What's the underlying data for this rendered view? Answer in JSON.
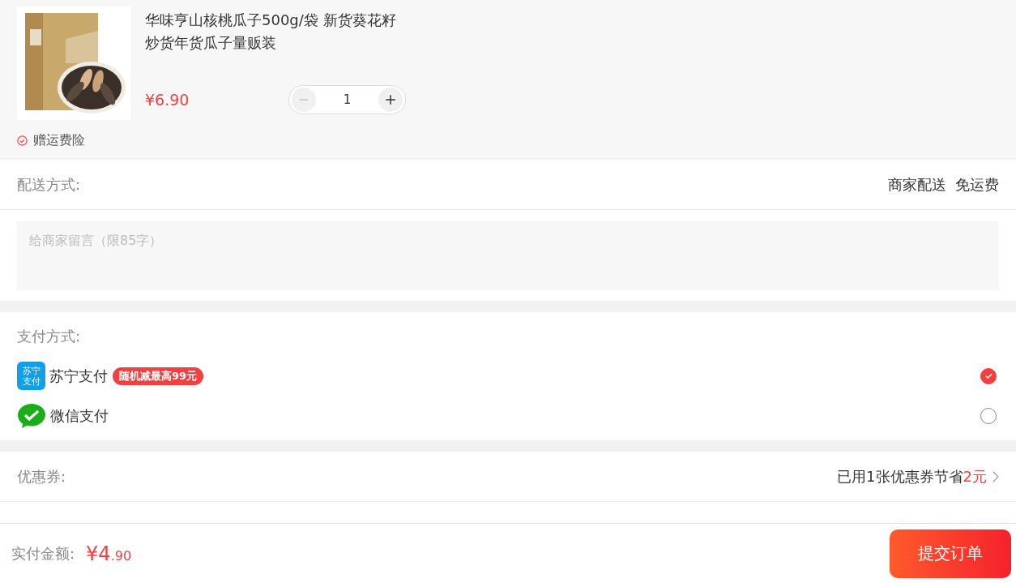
{
  "product": {
    "kind": "picture",
    "title": "华味亨山核桃瓜子500g/袋 新货葵花籽炒货年货瓜子量贩装",
    "price": "¥6.90",
    "quantity": "1",
    "minus_disabled": true,
    "insurance": "赠运费险"
  },
  "delivery": {
    "label": "配送方式:",
    "value": "商家配送  免运费"
  },
  "message": {
    "placeholder": "给商家留言（限85字）"
  },
  "payment": {
    "label": "支付方式:",
    "methods": [
      {
        "kind": "suning",
        "icon_text": "苏宁支付",
        "name": "苏宁支付",
        "badge": "随机减最高99元",
        "selected": true
      },
      {
        "kind": "wechat",
        "name": "微信支付",
        "selected": false
      }
    ]
  },
  "coupon": {
    "label": "优惠券:",
    "value": "已用1张优惠券节省",
    "saving": "2元"
  },
  "footer": {
    "label": "实付金额:",
    "amount_main": "¥4",
    "amount_decimal": ".90",
    "button": "提交订单"
  }
}
